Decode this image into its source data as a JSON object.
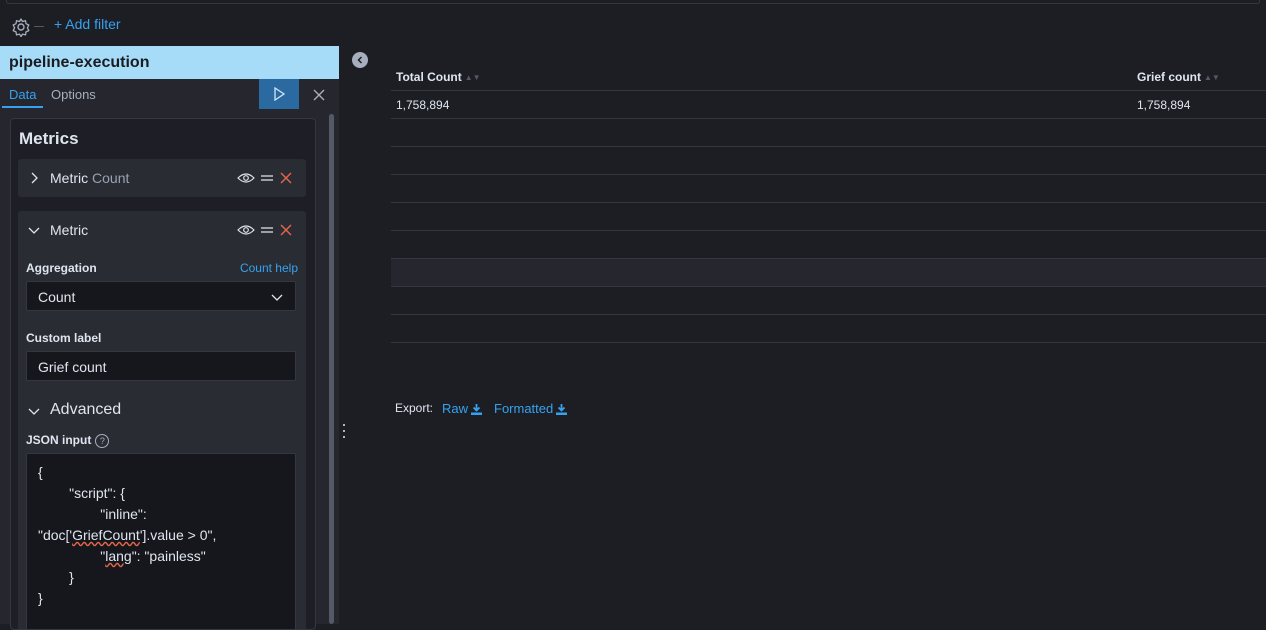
{
  "filters": {
    "add_filter_label": "+ Add filter"
  },
  "sidebar": {
    "index_title": "pipeline-execution",
    "tabs": [
      {
        "label": "Data"
      },
      {
        "label": "Options"
      }
    ],
    "metrics_title": "Metrics",
    "metric_1": {
      "label": "Metric",
      "sublabel": "Count"
    },
    "metric_2": {
      "label": "Metric",
      "aggregation_label": "Aggregation",
      "help_link": "Count help",
      "aggregation_value": "Count",
      "custom_label_label": "Custom label",
      "custom_label_value": "Grief count",
      "advanced_label": "Advanced",
      "json_input_label": "JSON input",
      "json_help_glyph": "?",
      "json_lines": {
        "l1": "{",
        "l2": "        \"script\": {",
        "l3": "                \"inline\":",
        "l4a": "\"doc['",
        "l4b": "GriefCount",
        "l4c": "'].value > 0\",",
        "l5a": "                \"",
        "l5b": "lang",
        "l5c": "\": \"painless\"",
        "l6": "        }",
        "l7": "}"
      }
    }
  },
  "table": {
    "columns": [
      "Total Count",
      "Grief count"
    ],
    "rows": [
      [
        "1,758,894",
        "1,758,894"
      ]
    ]
  },
  "export": {
    "label": "Export:",
    "raw": "Raw",
    "formatted": "Formatted"
  },
  "colors": {
    "accent": "#36a2ef",
    "index_bg": "#a6dcf8",
    "danger": "#e7664c",
    "run_btn": "#2b6aa0"
  }
}
